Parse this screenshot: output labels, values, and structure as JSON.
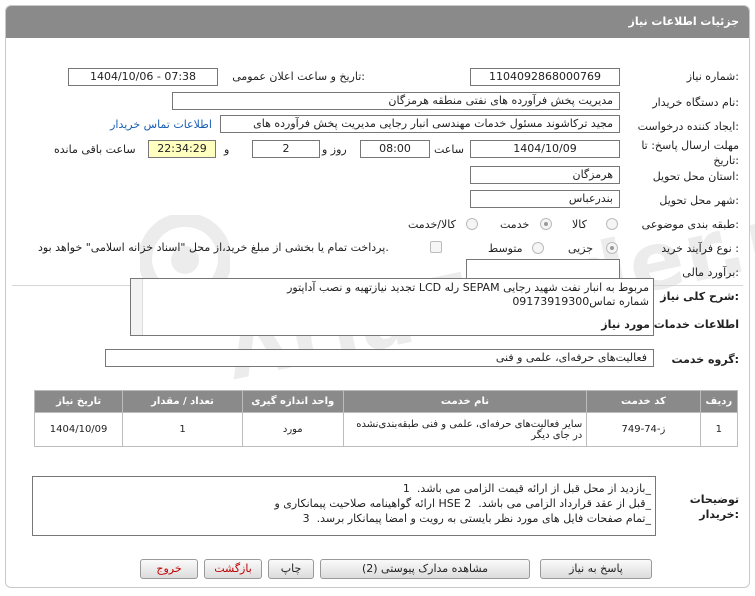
{
  "header": {
    "title": "جزئیات اطلاعات نیاز"
  },
  "fields": {
    "need_number_label": "شماره نیاز:",
    "need_number": "1104092868000769",
    "announce_label": "تاریخ و ساعت اعلان عمومی:",
    "announce_value": "1404/10/06 - 07:38",
    "buyer_org_label": "نام دستگاه خریدار:",
    "buyer_org": "مدیریت پخش فرآورده های نفتی منطقه هرمزگان",
    "requester_label": "ایجاد کننده درخواست:",
    "requester": "مجید ترکاشوند مسئول خدمات مهندسی انبار رجایی مدیریت پخش فرآورده های",
    "contact_link": "اطلاعات تماس خریدار",
    "deadline_label": "مهلت ارسال پاسخ: تا تاریخ:",
    "deadline_date": "1404/10/09",
    "time_label": "ساعت",
    "deadline_time": "08:00",
    "days_label": "روز و",
    "days": "2",
    "remaining_time": "22:34:29",
    "remaining_label": "ساعت باقی مانده",
    "province_label": "استان محل تحویل:",
    "province": "هرمزگان",
    "city_label": "شهر محل تحویل:",
    "city": "بندرعباس",
    "category_label": "طبقه بندی موضوعی:",
    "category_options": [
      "کالا",
      "خدمت",
      "کالا/خدمت"
    ],
    "process_label": "نوع فرآیند خرید :",
    "process_options": [
      "جزیی",
      "متوسط"
    ],
    "payment_note": "پرداخت تمام یا بخشی از مبلغ خرید،از محل \"اسناد خزانه اسلامی\" خواهد بود.",
    "budget_label": "برآورد مالی:",
    "budget": ""
  },
  "description": {
    "label": "شرح کلی نیاز:",
    "text_line1": "تجدید نیازتهیه و نصب آداپتور LCD رله SEPAM مربوط به انبار نفت شهید رجایی",
    "text_line2": "شماره تماس09173919300"
  },
  "services": {
    "section_title": "اطلاعات خدمات مورد نیاز",
    "group_label": "گروه خدمت:",
    "group_value": "فعالیت‌های حرفه‌ای، علمی و فنی",
    "columns": [
      "ردیف",
      "کد خدمت",
      "نام خدمت",
      "واحد اندازه گیری",
      "تعداد / مقدار",
      "تاریخ نیاز"
    ],
    "rows": [
      {
        "idx": "1",
        "code": "ز-74-749",
        "name": "سایر فعالیت‌های حرفه‌ای، علمی و فنی طبقه‌بندی‌نشده در جای دیگر",
        "unit": "مورد",
        "qty": "1",
        "date": "1404/10/09"
      }
    ]
  },
  "buyer_notes": {
    "label": "توضیحات خریدار:",
    "lines": [
      "بازدید از محل قبل از ارائه قیمت الزامی می باشد.",
      "ارائه گواهینامه صلاحیت پیمانکاری و HSE قبل از عقد قرارداد الزامی می باشد.",
      "تمام صفحات فایل های مورد نظر بایستی به رویت و امضا پیمانکار برسد."
    ],
    "markers": [
      "1_",
      "2_",
      "3_"
    ]
  },
  "buttons": {
    "reply": "پاسخ به نیاز",
    "attachments": "مشاهده مدارک پیوستی (2)",
    "print": "چاپ",
    "back": "بازگشت",
    "exit": "خروج"
  },
  "watermark": "AriaTender.net"
}
